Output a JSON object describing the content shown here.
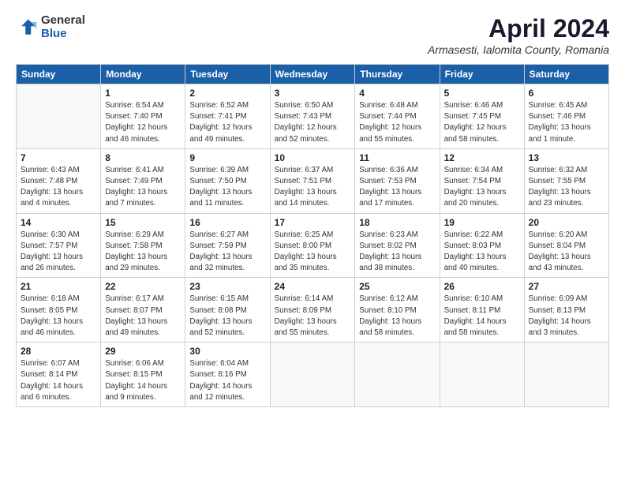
{
  "header": {
    "logo_general": "General",
    "logo_blue": "Blue",
    "title": "April 2024",
    "location": "Armasesti, Ialomita County, Romania"
  },
  "weekdays": [
    "Sunday",
    "Monday",
    "Tuesday",
    "Wednesday",
    "Thursday",
    "Friday",
    "Saturday"
  ],
  "weeks": [
    [
      {
        "day": "",
        "info": ""
      },
      {
        "day": "1",
        "info": "Sunrise: 6:54 AM\nSunset: 7:40 PM\nDaylight: 12 hours\nand 46 minutes."
      },
      {
        "day": "2",
        "info": "Sunrise: 6:52 AM\nSunset: 7:41 PM\nDaylight: 12 hours\nand 49 minutes."
      },
      {
        "day": "3",
        "info": "Sunrise: 6:50 AM\nSunset: 7:43 PM\nDaylight: 12 hours\nand 52 minutes."
      },
      {
        "day": "4",
        "info": "Sunrise: 6:48 AM\nSunset: 7:44 PM\nDaylight: 12 hours\nand 55 minutes."
      },
      {
        "day": "5",
        "info": "Sunrise: 6:46 AM\nSunset: 7:45 PM\nDaylight: 12 hours\nand 58 minutes."
      },
      {
        "day": "6",
        "info": "Sunrise: 6:45 AM\nSunset: 7:46 PM\nDaylight: 13 hours\nand 1 minute."
      }
    ],
    [
      {
        "day": "7",
        "info": "Sunrise: 6:43 AM\nSunset: 7:48 PM\nDaylight: 13 hours\nand 4 minutes."
      },
      {
        "day": "8",
        "info": "Sunrise: 6:41 AM\nSunset: 7:49 PM\nDaylight: 13 hours\nand 7 minutes."
      },
      {
        "day": "9",
        "info": "Sunrise: 6:39 AM\nSunset: 7:50 PM\nDaylight: 13 hours\nand 11 minutes."
      },
      {
        "day": "10",
        "info": "Sunrise: 6:37 AM\nSunset: 7:51 PM\nDaylight: 13 hours\nand 14 minutes."
      },
      {
        "day": "11",
        "info": "Sunrise: 6:36 AM\nSunset: 7:53 PM\nDaylight: 13 hours\nand 17 minutes."
      },
      {
        "day": "12",
        "info": "Sunrise: 6:34 AM\nSunset: 7:54 PM\nDaylight: 13 hours\nand 20 minutes."
      },
      {
        "day": "13",
        "info": "Sunrise: 6:32 AM\nSunset: 7:55 PM\nDaylight: 13 hours\nand 23 minutes."
      }
    ],
    [
      {
        "day": "14",
        "info": "Sunrise: 6:30 AM\nSunset: 7:57 PM\nDaylight: 13 hours\nand 26 minutes."
      },
      {
        "day": "15",
        "info": "Sunrise: 6:29 AM\nSunset: 7:58 PM\nDaylight: 13 hours\nand 29 minutes."
      },
      {
        "day": "16",
        "info": "Sunrise: 6:27 AM\nSunset: 7:59 PM\nDaylight: 13 hours\nand 32 minutes."
      },
      {
        "day": "17",
        "info": "Sunrise: 6:25 AM\nSunset: 8:00 PM\nDaylight: 13 hours\nand 35 minutes."
      },
      {
        "day": "18",
        "info": "Sunrise: 6:23 AM\nSunset: 8:02 PM\nDaylight: 13 hours\nand 38 minutes."
      },
      {
        "day": "19",
        "info": "Sunrise: 6:22 AM\nSunset: 8:03 PM\nDaylight: 13 hours\nand 40 minutes."
      },
      {
        "day": "20",
        "info": "Sunrise: 6:20 AM\nSunset: 8:04 PM\nDaylight: 13 hours\nand 43 minutes."
      }
    ],
    [
      {
        "day": "21",
        "info": "Sunrise: 6:18 AM\nSunset: 8:05 PM\nDaylight: 13 hours\nand 46 minutes."
      },
      {
        "day": "22",
        "info": "Sunrise: 6:17 AM\nSunset: 8:07 PM\nDaylight: 13 hours\nand 49 minutes."
      },
      {
        "day": "23",
        "info": "Sunrise: 6:15 AM\nSunset: 8:08 PM\nDaylight: 13 hours\nand 52 minutes."
      },
      {
        "day": "24",
        "info": "Sunrise: 6:14 AM\nSunset: 8:09 PM\nDaylight: 13 hours\nand 55 minutes."
      },
      {
        "day": "25",
        "info": "Sunrise: 6:12 AM\nSunset: 8:10 PM\nDaylight: 13 hours\nand 58 minutes."
      },
      {
        "day": "26",
        "info": "Sunrise: 6:10 AM\nSunset: 8:11 PM\nDaylight: 14 hours\nand 58 minutes."
      },
      {
        "day": "27",
        "info": "Sunrise: 6:09 AM\nSunset: 8:13 PM\nDaylight: 14 hours\nand 3 minutes."
      }
    ],
    [
      {
        "day": "28",
        "info": "Sunrise: 6:07 AM\nSunset: 8:14 PM\nDaylight: 14 hours\nand 6 minutes."
      },
      {
        "day": "29",
        "info": "Sunrise: 6:06 AM\nSunset: 8:15 PM\nDaylight: 14 hours\nand 9 minutes."
      },
      {
        "day": "30",
        "info": "Sunrise: 6:04 AM\nSunset: 8:16 PM\nDaylight: 14 hours\nand 12 minutes."
      },
      {
        "day": "",
        "info": ""
      },
      {
        "day": "",
        "info": ""
      },
      {
        "day": "",
        "info": ""
      },
      {
        "day": "",
        "info": ""
      }
    ]
  ]
}
